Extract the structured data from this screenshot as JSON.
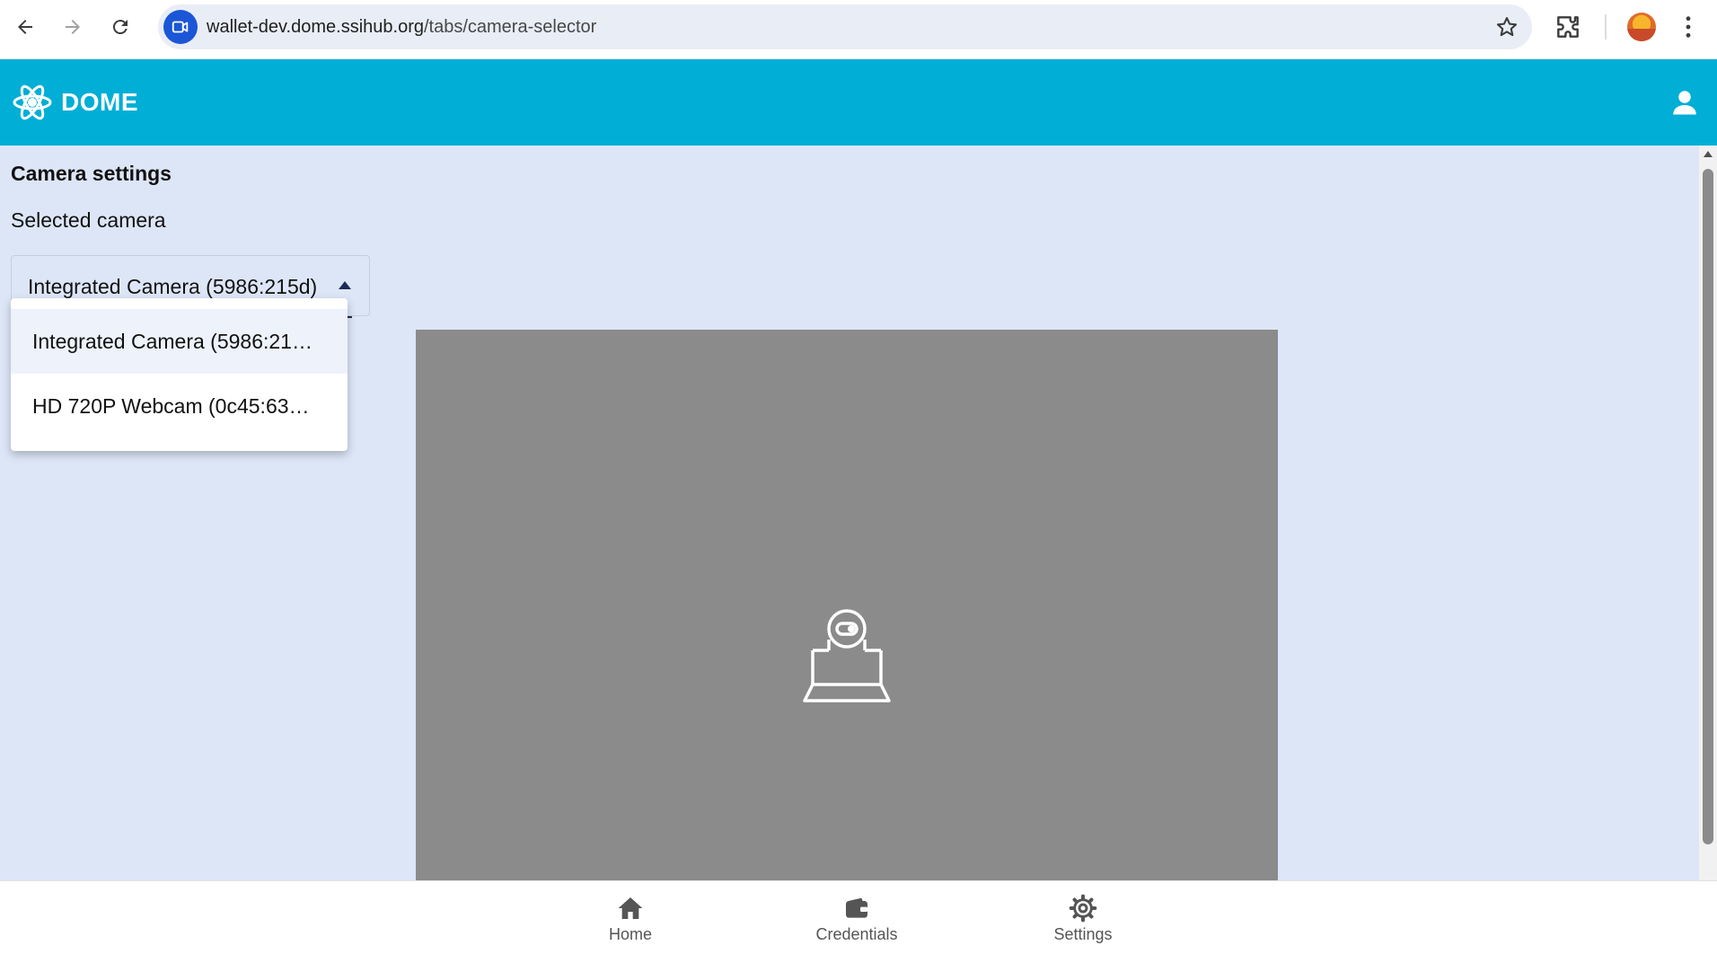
{
  "browser": {
    "url_domain": "wallet-dev.dome.ssihub.org",
    "url_path": "/tabs/camera-selector"
  },
  "header": {
    "logo_text": "DOME"
  },
  "page": {
    "title": "Camera settings",
    "selected_camera_label": "Selected camera",
    "selected_camera_value": "Integrated Camera (5986:215d)"
  },
  "dropdown": {
    "options": [
      {
        "label": "Integrated Camera (5986:21…",
        "selected": true
      },
      {
        "label": "HD 720P Webcam (0c45:63…",
        "selected": false
      }
    ]
  },
  "tabs": [
    {
      "label": "Home",
      "icon": "home-icon"
    },
    {
      "label": "Credentials",
      "icon": "wallet-icon"
    },
    {
      "label": "Settings",
      "icon": "gear-icon"
    }
  ],
  "colors": {
    "header_bg": "#00aed6",
    "content_bg": "#dde6f7",
    "preview_bg": "#8b8b8c"
  }
}
